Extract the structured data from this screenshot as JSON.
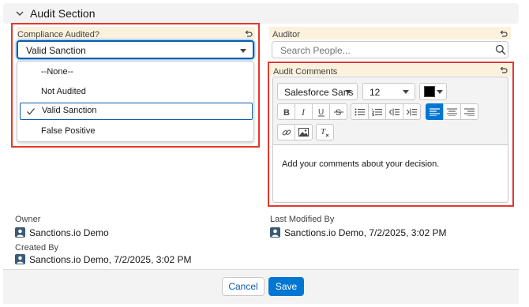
{
  "section": {
    "title": "Audit Section"
  },
  "compliance": {
    "label": "Compliance Audited?",
    "value": "Valid Sanction",
    "options": [
      "--None--",
      "Not Audited",
      "Valid Sanction",
      "False Positive"
    ]
  },
  "auditor": {
    "label": "Auditor",
    "placeholder": "Search People..."
  },
  "comments": {
    "label": "Audit Comments",
    "font": "Salesforce Sans",
    "size": "12",
    "color": "#000000",
    "body": "Add your comments about your decision."
  },
  "meta": {
    "owner_label": "Owner",
    "owner_value": "Sanctions.io Demo",
    "modified_label": "Last Modified By",
    "modified_value": "Sanctions.io Demo, 7/2/2025, 3:02 PM",
    "created_label": "Created By",
    "created_value": "Sanctions.io Demo, 7/2/2025, 3:02 PM"
  },
  "footer": {
    "cancel": "Cancel",
    "save": "Save"
  },
  "colors": {
    "brand": "#0176d3",
    "highlight": "#e4382c",
    "edit_bg": "#fbf1dd"
  }
}
